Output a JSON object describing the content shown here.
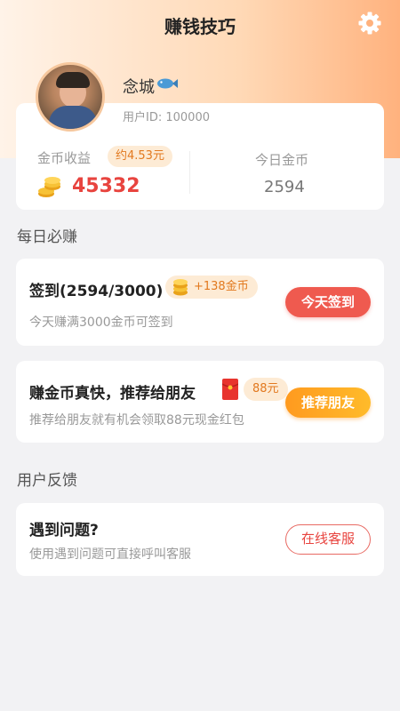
{
  "header": {
    "title": "赚钱技巧",
    "settings_icon": "gear-icon"
  },
  "profile": {
    "name": "念城",
    "name_emoji_icon": "fish-icon",
    "user_id": "用户ID: 100000",
    "coin_income_label": "金币收益",
    "approx_value": "约4.53元",
    "coin_total": "45332",
    "today_label": "今日金币",
    "today_value": "2594"
  },
  "daily": {
    "section_title": "每日必赚",
    "checkin": {
      "title": "签到(2594/3000)",
      "bonus": "+138金币",
      "subtitle": "今天赚满3000金币可签到",
      "button": "今天签到"
    },
    "recommend": {
      "title": "赚金币真快，推荐给朋友",
      "bonus": "88元",
      "subtitle": "推荐给朋友就有机会领取88元现金红包",
      "button": "推荐朋友"
    }
  },
  "feedback": {
    "section_title": "用户反馈",
    "title": "遇到问题?",
    "subtitle": "使用遇到问题可直接呼叫客服",
    "button": "在线客服"
  },
  "colors": {
    "accent_red": "#ef5a4f",
    "accent_orange": "#ffa21f",
    "badge_bg": "#fdebd5"
  }
}
